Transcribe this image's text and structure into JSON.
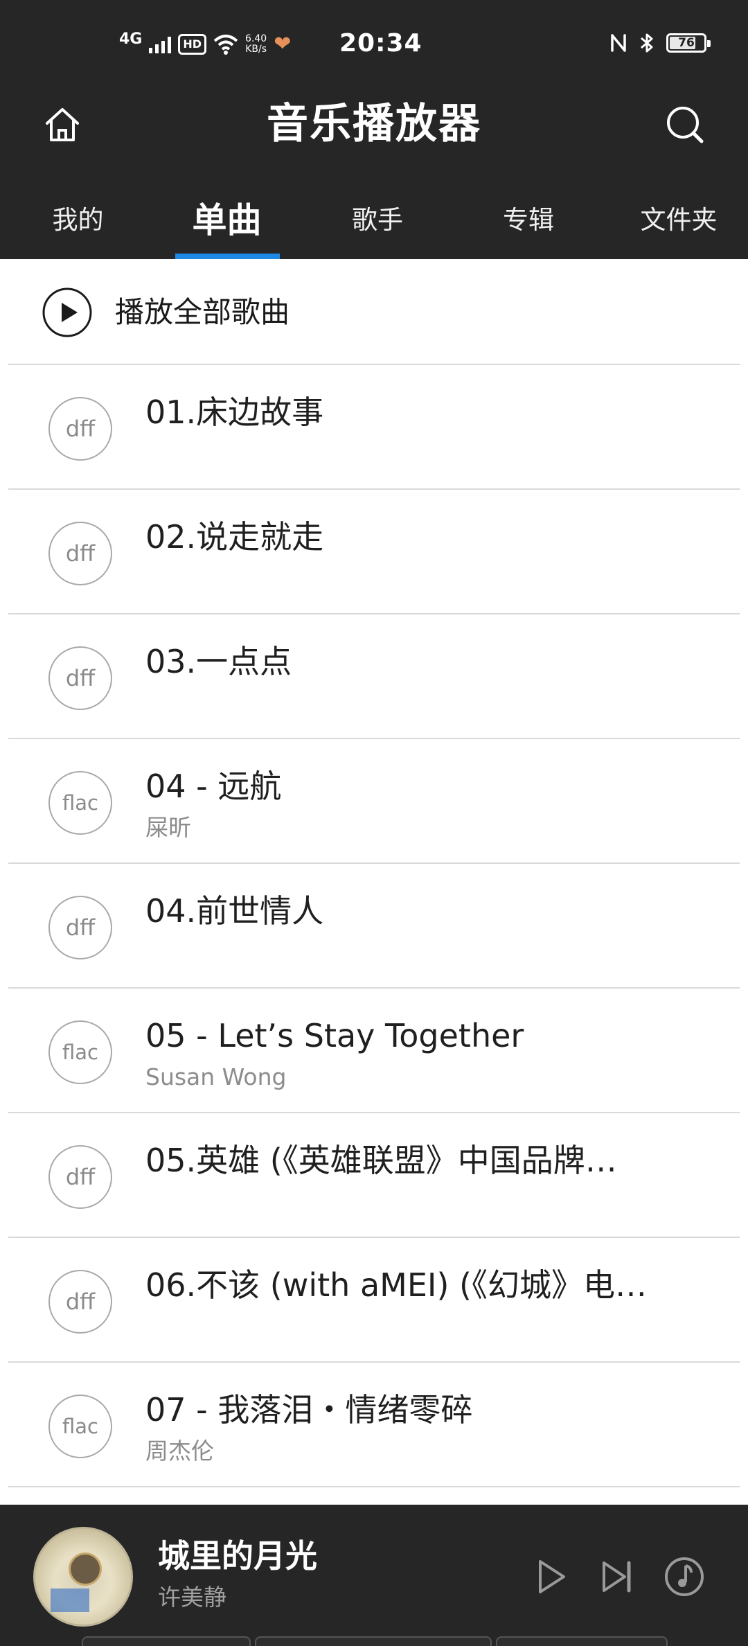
{
  "status_bar": {
    "network": "4G",
    "hd": "HD",
    "speed_value": "6.40",
    "speed_unit": "KB/s",
    "time": "20:34",
    "battery": "76"
  },
  "app": {
    "title": "音乐播放器"
  },
  "tabs": [
    {
      "label": "我的",
      "active": false
    },
    {
      "label": "单曲",
      "active": true
    },
    {
      "label": "歌手",
      "active": false
    },
    {
      "label": "专辑",
      "active": false
    },
    {
      "label": "文件夹",
      "active": false
    }
  ],
  "play_all": {
    "label": "播放全部歌曲"
  },
  "songs": [
    {
      "format": "dff",
      "title": "01.床边故事",
      "artist": ""
    },
    {
      "format": "dff",
      "title": "02.说走就走",
      "artist": ""
    },
    {
      "format": "dff",
      "title": "03.一点点",
      "artist": ""
    },
    {
      "format": "flac",
      "title": "04 - 远航",
      "artist": "屎昕"
    },
    {
      "format": "dff",
      "title": "04.前世情人",
      "artist": ""
    },
    {
      "format": "flac",
      "title": "05 - Let’s Stay Together",
      "artist": "Susan Wong"
    },
    {
      "format": "dff",
      "title": "05.英雄 (《英雄联盟》中国品牌…",
      "artist": ""
    },
    {
      "format": "dff",
      "title": "06.不该 (with aMEI) (《幻城》电…",
      "artist": ""
    },
    {
      "format": "flac",
      "title": "07 - 我落泪・情绪零碎",
      "artist": "周杰伦"
    }
  ],
  "now_playing": {
    "title": "城里的月光",
    "artist": "许美静"
  },
  "colors": {
    "bar_background": "#262626",
    "tab_indicator": "#1e88e5",
    "list_background": "#ffffff"
  }
}
